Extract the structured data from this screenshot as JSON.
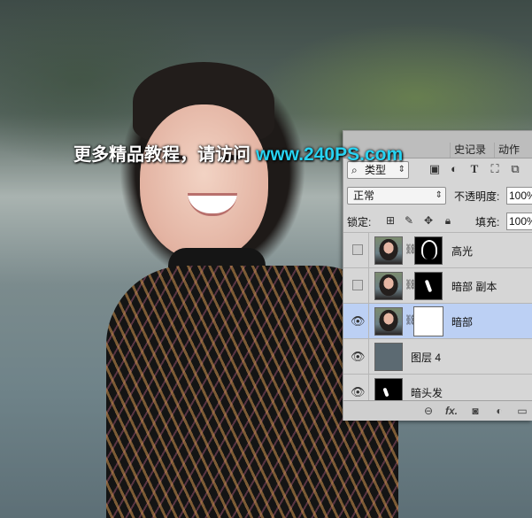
{
  "watermark": {
    "text": "更多精品教程，请访问",
    "url": "www.240PS.com"
  },
  "panel": {
    "tabs": [
      {
        "label": "史记录"
      },
      {
        "label": "动作"
      }
    ],
    "filter": {
      "kind_label": "类型",
      "icons": [
        "image-filter-icon",
        "adjustment-filter-icon",
        "type-filter-icon",
        "shape-filter-icon",
        "smart-object-filter-icon"
      ]
    },
    "blend": {
      "mode": "正常",
      "opacity_label": "不透明度:",
      "opacity_value": "100%"
    },
    "lock": {
      "label": "锁定:",
      "fill_label": "填充:",
      "fill_value": "100%"
    },
    "layers": [
      {
        "name": "高光",
        "visible": false,
        "mask": "hair-outline"
      },
      {
        "name": "暗部 副本",
        "visible": false,
        "mask": "streak"
      },
      {
        "name": "暗部",
        "visible": true,
        "mask": "white",
        "selected": true
      },
      {
        "name": "图层 4",
        "visible": true
      },
      {
        "name": "暗头发",
        "visible": true
      }
    ],
    "footer_icons": [
      "link-layers-icon",
      "fx-icon",
      "add-mask-icon",
      "new-adjustment-icon",
      "new-group-icon"
    ],
    "footer_fx": "fx."
  },
  "colors": {
    "selected_row": "#bcd0f4",
    "watermark_url": "#27d3f2",
    "panel_bg": "#d6d6d6"
  }
}
